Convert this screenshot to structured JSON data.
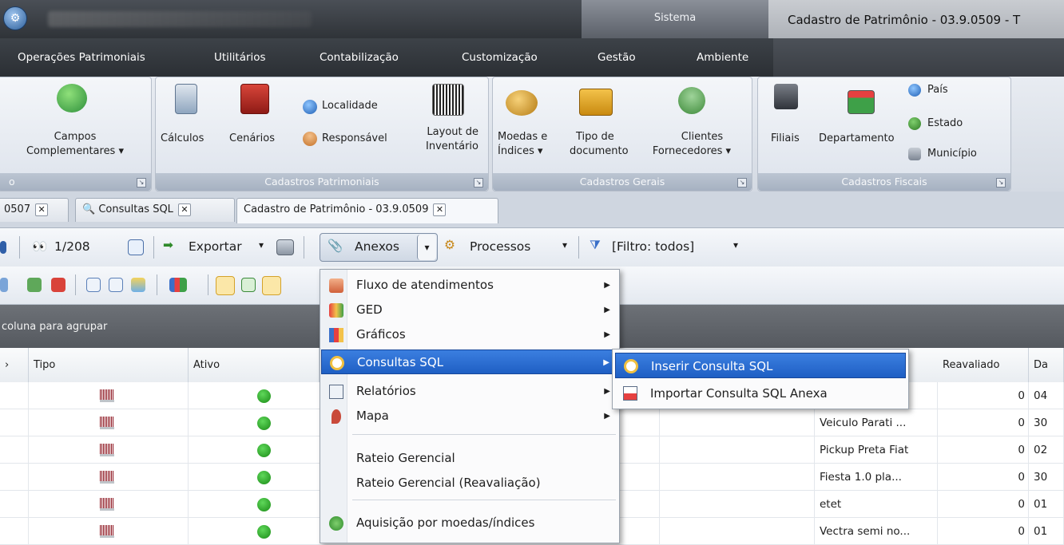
{
  "titlebar": {
    "sistema_label": "Sistema",
    "window_title": "Cadastro de Patrimônio - 03.9.0509 - T"
  },
  "menubar": {
    "items": [
      "Operações Patrimoniais",
      "Utilitários",
      "Contabilização",
      "Customização",
      "Gestão",
      "Ambiente"
    ]
  },
  "ribbon": {
    "campos": {
      "line1": "Campos",
      "line2": "Complementares ▾",
      "left_fragment": "o"
    },
    "calculos": "Cálculos",
    "cenarios": "Cenários",
    "localidade": "Localidade",
    "responsavel": "Responsável",
    "layout": {
      "line1": "Layout de",
      "line2": "Inventário"
    },
    "moedas": {
      "line1": "Moedas e",
      "line2": "Índices ▾"
    },
    "tipo": {
      "line1": "Tipo de",
      "line2": "documento"
    },
    "clientes": {
      "line1": "Clientes",
      "line2": "Fornecedores ▾"
    },
    "filiais": "Filiais",
    "departamento": "Departamento",
    "pais": "País",
    "estado": "Estado",
    "municipio": "Município",
    "group_titles": {
      "first": "o",
      "patrimoniais": "Cadastros Patrimoniais",
      "gerais": "Cadastros Gerais",
      "fiscais": "Cadastros Fiscais"
    }
  },
  "tabs": [
    {
      "label": "0507"
    },
    {
      "label": "Consultas SQL"
    },
    {
      "label": "Cadastro de Patrimônio - 03.9.0509"
    }
  ],
  "toolbar": {
    "record_counter": "1/208",
    "exportar": "Exportar",
    "anexos": "Anexos",
    "processos": "Processos",
    "filtro": "[Filtro: todos]"
  },
  "groupbar": {
    "text": "coluna para agrupar"
  },
  "grid": {
    "columns": {
      "tipo": "Tipo",
      "ativo": "Ativo",
      "reavaliado": "Reavaliado",
      "da": "Da"
    },
    "rows": [
      {
        "descricao": "...",
        "reavaliado": "0",
        "da": "04"
      },
      {
        "descricao": "Veiculo Parati ...",
        "reavaliado": "0",
        "da": "30"
      },
      {
        "descricao": "Pickup Preta Fiat",
        "reavaliado": "0",
        "da": "02"
      },
      {
        "descricao": "Fiesta 1.0  pla...",
        "reavaliado": "0",
        "da": "30"
      },
      {
        "descricao": "etet",
        "reavaliado": "0",
        "da": "01"
      },
      {
        "descricao": "Vectra semi no...",
        "reavaliado": "0",
        "da": "01"
      }
    ]
  },
  "anexos_menu": {
    "items": [
      {
        "label": "Fluxo de atendimentos",
        "has_submenu": true
      },
      {
        "label": "GED",
        "has_submenu": true
      },
      {
        "label": "Gráficos",
        "has_submenu": true
      },
      {
        "label": "Consultas SQL",
        "has_submenu": true
      },
      {
        "label": "Relatórios",
        "has_submenu": true
      },
      {
        "label": "Mapa",
        "has_submenu": true
      },
      {
        "label": "Rateio Gerencial",
        "has_submenu": false
      },
      {
        "label": "Rateio Gerencial (Reavaliação)",
        "has_submenu": false
      },
      {
        "label": "Aquisição por moedas/índices",
        "has_submenu": false
      }
    ]
  },
  "consultas_submenu": {
    "items": [
      "Inserir Consulta SQL",
      "Importar Consulta SQL Anexa"
    ]
  }
}
